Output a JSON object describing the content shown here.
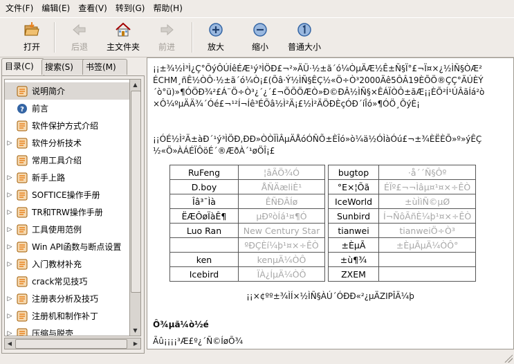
{
  "menu": {
    "items": [
      "文件(F)",
      "编辑(E)",
      "查看(V)",
      "转到(G)",
      "帮助(H)"
    ]
  },
  "toolbar": {
    "open": "打开",
    "back": "后退",
    "home": "主文件夹",
    "forward": "前进",
    "zoom_in": "放大",
    "zoom_out": "缩小",
    "normal_size": "普通大小"
  },
  "sidebar": {
    "tabs": [
      "目录(C)",
      "搜索(S)",
      "书签(M)"
    ],
    "items": [
      {
        "label": "说明简介",
        "icon": "page",
        "expandable": false,
        "selected": true
      },
      {
        "label": "前言",
        "icon": "help",
        "expandable": false,
        "selected": false
      },
      {
        "label": "软件保护方式介绍",
        "icon": "page",
        "expandable": false,
        "selected": false
      },
      {
        "label": "软件分析技术",
        "icon": "page",
        "expandable": true,
        "selected": false
      },
      {
        "label": "常用工具介绍",
        "icon": "page",
        "expandable": false,
        "selected": false
      },
      {
        "label": "新手上路",
        "icon": "page",
        "expandable": true,
        "selected": false
      },
      {
        "label": "SOFTICE操作手册",
        "icon": "page",
        "expandable": true,
        "selected": false
      },
      {
        "label": "TR和TRW操作手册",
        "icon": "page",
        "expandable": true,
        "selected": false
      },
      {
        "label": "工具使用范例",
        "icon": "page",
        "expandable": true,
        "selected": false
      },
      {
        "label": "Win API函数与断点设置",
        "icon": "page",
        "expandable": true,
        "selected": false
      },
      {
        "label": "入门教材补充",
        "icon": "page",
        "expandable": true,
        "selected": false
      },
      {
        "label": "crack常见技巧",
        "icon": "page",
        "expandable": false,
        "selected": false
      },
      {
        "label": "注册表分析及技巧",
        "icon": "page",
        "expandable": true,
        "selected": false
      },
      {
        "label": "注册机和制作补丁",
        "icon": "page",
        "expandable": true,
        "selected": false
      },
      {
        "label": "压缩与脱壳",
        "icon": "page",
        "expandable": true,
        "selected": false
      }
    ]
  },
  "content": {
    "para1": "¡¡±¾½Ì³Ì¿Ç°ÕýÔÚÍêÉÆ¹ý³ÌÖÐ£¬²»ÄÜ·½±ã´ó¼ÒµÄÆ½Ê±Ñ§Ï°£¬Ï¤×¿½ÌÑ§ÒÆ²ÉCHM¸ñÊ½ÒÔ·½±ã´ó¼Ò¡£(Õâ·Ý½ÌÑ§ÊÇ½«Ö÷Ò³2000Äê5ÔÂ19ÈÕÖ®ÇÇ°ÄÚÈÝ´ò°ü)»¶Ó­ÖÐ¾²£Á¨Ö÷Ò³¿´¿´£¬ÕÕÖÆÒ»Ð©ÐÂ½ÌÑ§×ÊÁÏÒÔ±ãÆ¡¡ÈÕ²Í¹ÚÂãÍá²ò×Ô¼ºµÄÄ¾´Óé£¬¹²Í¬Íê³ÉÕâ½Ì²Ä¡£½Ì²ÄÖÐÈçÓÐ´íÎó»¶ÓÖ¸ÕýÈ¡",
    "para2": "¡¡ÓÉ½Ì²Ä±àÐ´¹ý³ÌÖÐ,ÐÐ»ÒÒÏÌÂµÄÅóÓÑÕ±ÈÎó»ò¼ä½ÓÌàÓú£¬±¾ÈËÈÕ»º»ýÊÇ½«Ö»ÀÁÉÏÔöÉ´®ÆðÀ´¹øÖÎ¡£",
    "caption": "¡¡×¢ºº±¾ÌÍ×½ÌÑ§ÀÚ´ÓÐÐ«²¿µÄZIPÎÄ¼þ",
    "heading": "Ô¾µã¼ò½é",
    "line_bottom": "Ãû¡¡¡¡³Æ£º¿´Ñ©ÍøÕ¾"
  },
  "credits_table": {
    "rows": [
      [
        "RuFeng",
        "¦âÃÖ¾Ó",
        "bugtop",
        "·å´´Ñ§Ôº"
      ],
      [
        "D.boy",
        "ÅÑÄæliÈ¹",
        "°E×¦Õã",
        "ÉÏº£¬¬Ìâµ¤¹¤×÷ÊÒ"
      ],
      [
        "Îâ³¯Ìà",
        "ÊÑÐÂÍø",
        "IceWorld",
        "±ùÌìÑ©µØ"
      ],
      [
        "ËÆÔøÏàÊ¶",
        "µÐºòÍá¹¤¶Ó",
        "Sunbird",
        "Í¬ÑôÃñÈ¼þ¹¤×÷ÊÒ"
      ],
      [
        "Luo Ran",
        "New Century Star",
        "tianwei",
        "tianweiÖ÷Ò³"
      ],
      [
        "",
        "ºÐÇÈí¼þ¹¤×÷ÊÒ",
        "±ÈµÃ",
        "±ÈµÃµÄ¼ÒÔ°"
      ],
      [
        "ken",
        "kenµÄ¼ÒÔ",
        "±ù¶¾",
        ""
      ],
      [
        "Icebird",
        "ÏÀ¿ÍµÄ¼ÒÔ",
        "ZXEM",
        ""
      ]
    ]
  },
  "colors": {
    "window_bg": "#efebe7",
    "icon_orange": "#e8821e",
    "icon_blue": "#3465a4",
    "gray_text": "#a7a7a7"
  }
}
